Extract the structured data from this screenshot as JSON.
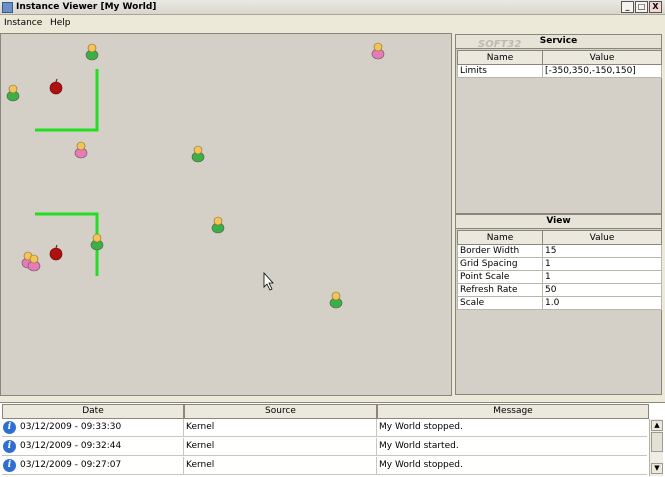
{
  "window": {
    "title": "Instance Viewer [My World]",
    "min": "_",
    "max": "□",
    "close": "X"
  },
  "menu": {
    "items": [
      "Instance",
      "Help"
    ]
  },
  "service": {
    "title": "Service",
    "col_name": "Name",
    "col_value": "Value",
    "rows": [
      {
        "name": "Limits",
        "value": "[-350,350,-150,150]"
      }
    ]
  },
  "view": {
    "title": "View",
    "col_name": "Name",
    "col_value": "Value",
    "rows": [
      {
        "name": "Border Width",
        "value": "15"
      },
      {
        "name": "Grid Spacing",
        "value": "1"
      },
      {
        "name": "Point Scale",
        "value": "1"
      },
      {
        "name": "Refresh Rate",
        "value": "50"
      },
      {
        "name": "Scale",
        "value": "1.0"
      }
    ]
  },
  "log": {
    "headers": {
      "date": "Date",
      "source": "Source",
      "message": "Message"
    },
    "rows": [
      {
        "date": "03/12/2009 - 09:33:30",
        "source": "Kernel",
        "message": "My World stopped."
      },
      {
        "date": "03/12/2009 - 09:32:44",
        "source": "Kernel",
        "message": "My World started."
      },
      {
        "date": "03/12/2009 - 09:27:07",
        "source": "Kernel",
        "message": "My World stopped."
      }
    ]
  },
  "colors": {
    "wall": "#22dd22",
    "green_agent": "#3cb043",
    "pink_agent": "#e87ab8",
    "apple": "#b01010",
    "canvas": "#d4d0c8"
  },
  "watermark": "SOFT32"
}
